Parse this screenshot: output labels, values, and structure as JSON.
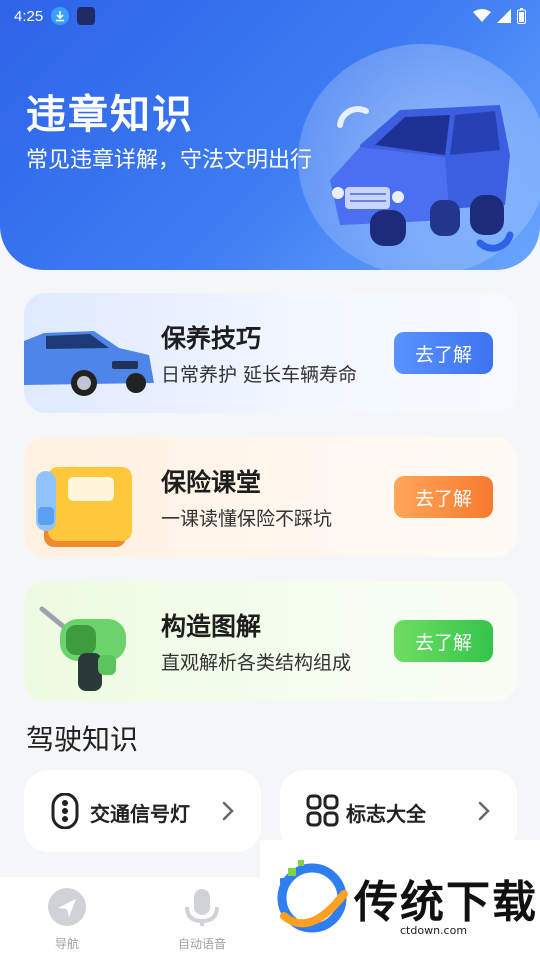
{
  "status_bar": {
    "time": "4:25"
  },
  "hero": {
    "title": "违章知识",
    "subtitle": "常见违章详解，守法文明出行"
  },
  "cards": [
    {
      "title": "保养技巧",
      "desc": "日常养护 延长车辆寿命",
      "button": "去了解",
      "color": "#3c74f0"
    },
    {
      "title": "保险课堂",
      "desc": "一课读懂保险不踩坑",
      "button": "去了解",
      "color": "#f77a2e"
    },
    {
      "title": "构造图解",
      "desc": "直观解析各类结构组成",
      "button": "去了解",
      "color": "#34c44a"
    }
  ],
  "section": {
    "title": "驾驶知识"
  },
  "quick_links": [
    {
      "label": "交通信号灯",
      "icon": "traffic-light-icon"
    },
    {
      "label": "标志大全",
      "icon": "grid-icon"
    }
  ],
  "bottom_nav": [
    {
      "label": "导航",
      "icon": "navigation-icon"
    },
    {
      "label": "自动语音",
      "icon": "microphone-icon"
    }
  ],
  "watermark": {
    "text": "传统下载",
    "url": "ctdown.com"
  }
}
